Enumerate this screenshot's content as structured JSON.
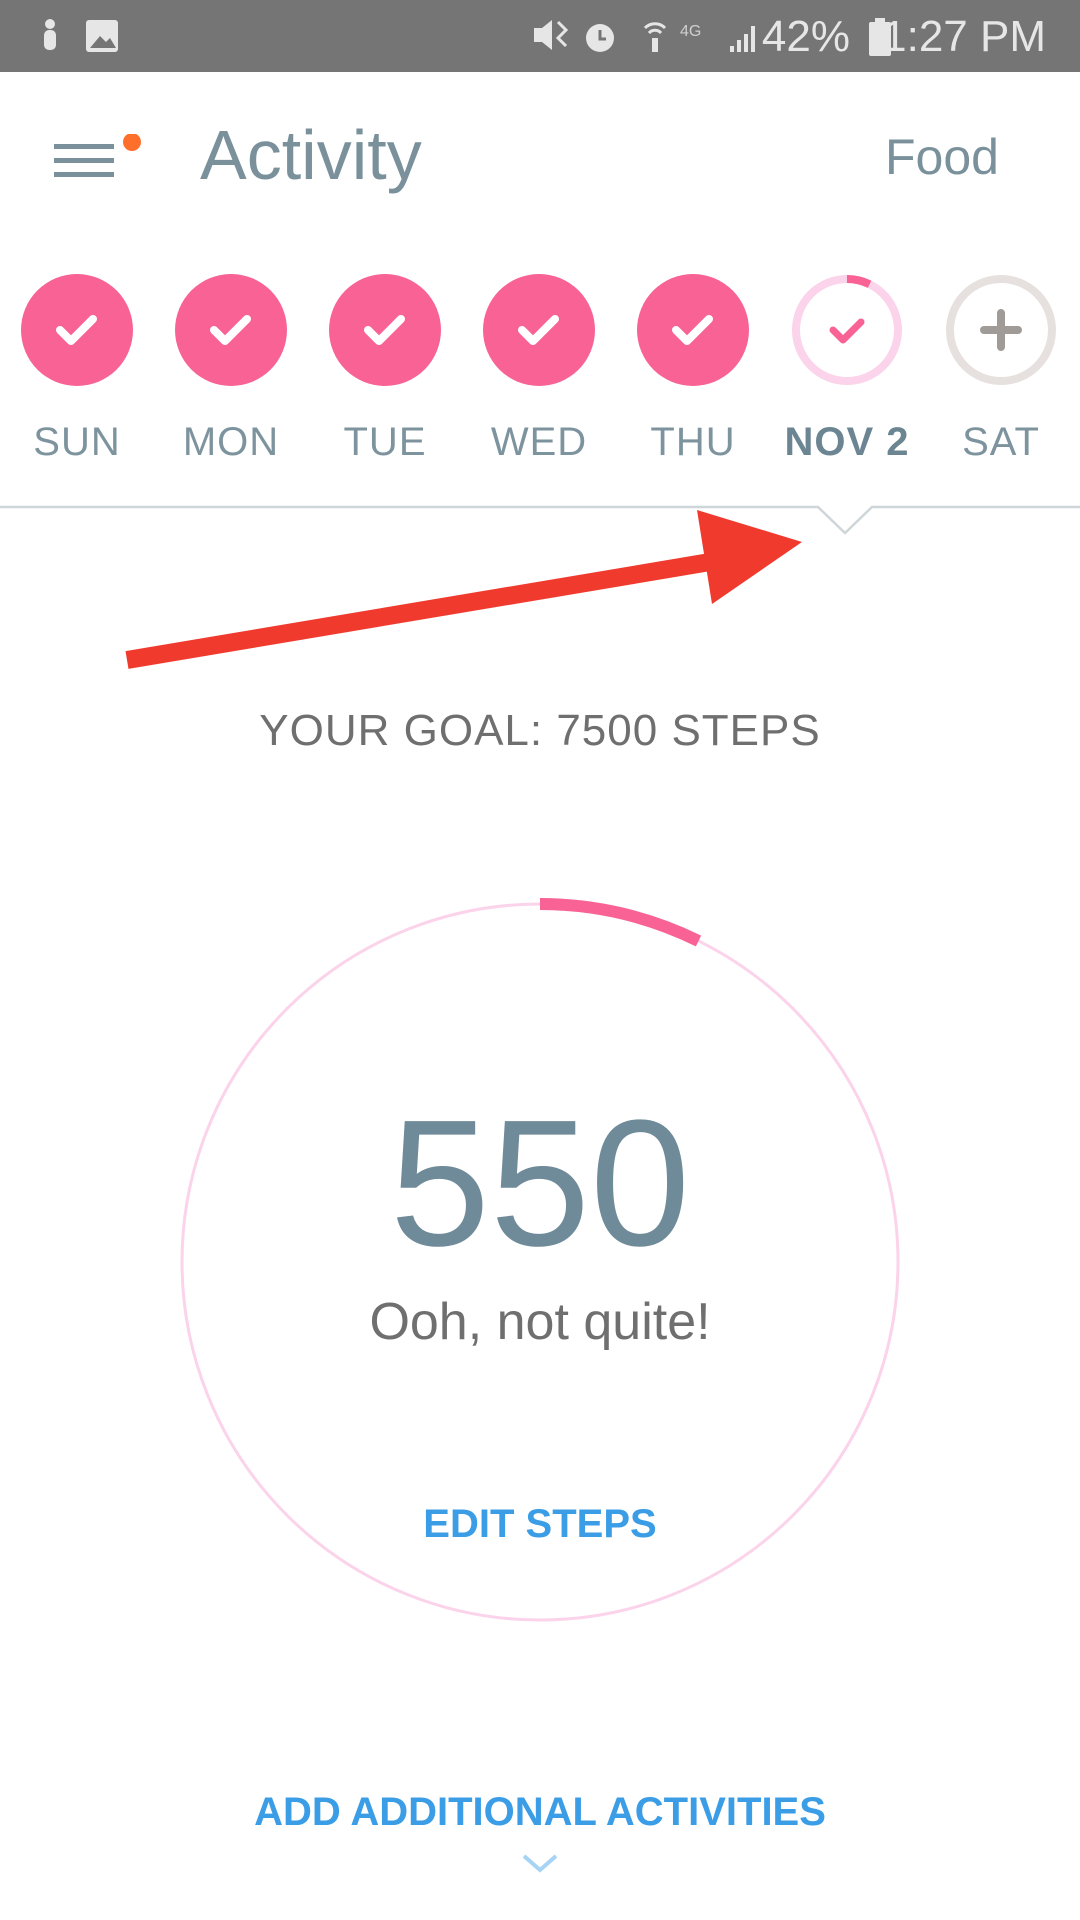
{
  "status_bar": {
    "battery": "42%",
    "time": "1:27 PM",
    "network": "4G"
  },
  "header": {
    "title": "Activity",
    "food_tab": "Food",
    "menu_badge_color": "#ff6f2c"
  },
  "days": [
    {
      "label": "SUN",
      "state": "complete"
    },
    {
      "label": "MON",
      "state": "complete"
    },
    {
      "label": "TUE",
      "state": "complete"
    },
    {
      "label": "WED",
      "state": "complete"
    },
    {
      "label": "THU",
      "state": "complete"
    },
    {
      "label": "NOV 2",
      "state": "selected",
      "progress": 0.073
    },
    {
      "label": "SAT",
      "state": "add"
    }
  ],
  "goal": {
    "text": "YOUR GOAL: 7500 STEPS"
  },
  "steps": {
    "count": "550",
    "message": "Ooh, not quite!",
    "progress": 0.073,
    "edit_label": "EDIT STEPS"
  },
  "footer": {
    "add_label": "ADD ADDITIONAL ACTIVITIES"
  },
  "colors": {
    "pink": "#f86295",
    "pink_light": "#fbd3ea",
    "link": "#3b9de6",
    "arrow": "#f03a2e"
  }
}
